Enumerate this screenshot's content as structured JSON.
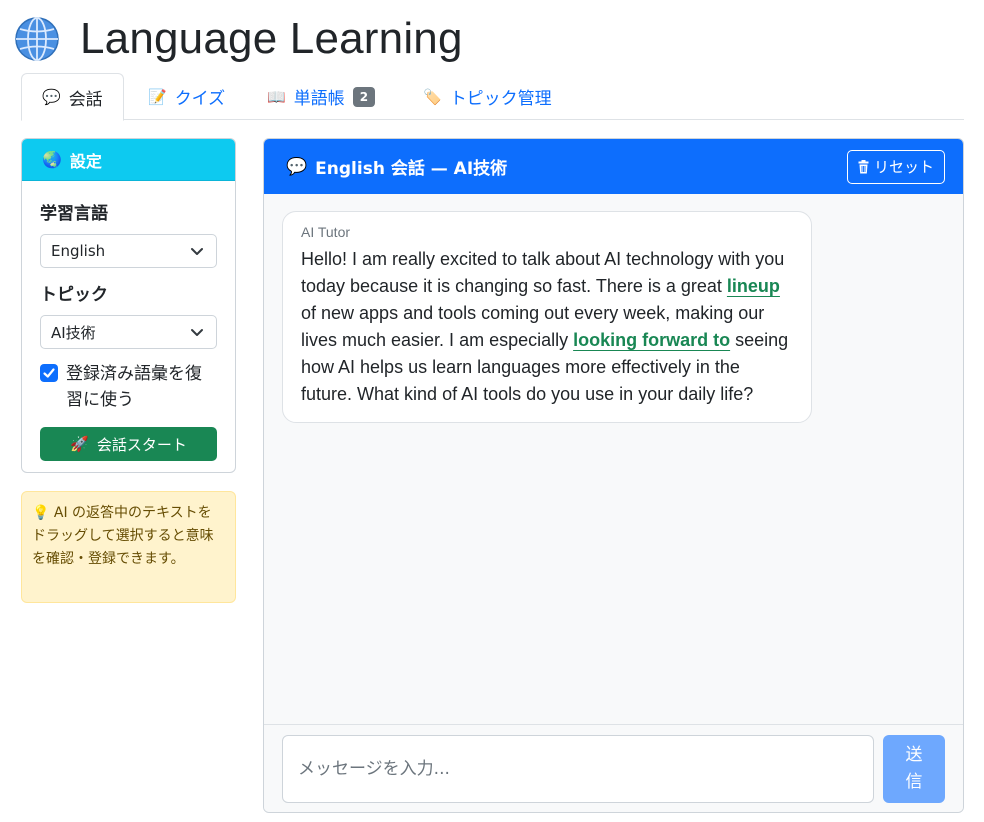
{
  "app": {
    "title": "Language Learning",
    "icon": "globe-icon"
  },
  "tabs": [
    {
      "label": "会話",
      "icon": "speech-bubble-icon",
      "active": true
    },
    {
      "label": "クイズ",
      "icon": "memo-icon",
      "active": false
    },
    {
      "label": "単語帳",
      "icon": "book-icon",
      "badge": "2",
      "active": false
    },
    {
      "label": "トピック管理",
      "icon": "tag-icon",
      "active": false
    }
  ],
  "settings": {
    "header": "設定",
    "language_label": "学習言語",
    "language_value": "English",
    "topic_label": "トピック",
    "topic_value": "AI技術",
    "use_vocab_label": "登録済み語彙を復習に使う",
    "use_vocab_checked": true,
    "start_button": "会話スタート"
  },
  "tip": {
    "text": "AI の返答中のテキストをドラッグして選択すると意味を確認・登録できます。"
  },
  "chat": {
    "title": "English 会話 — AI技術",
    "reset_button": "リセット",
    "messages": [
      {
        "sender": "AI Tutor",
        "segments": [
          "Hello! I am really excited to talk about AI technology with you today because it is changing so fast. There is a great ",
          "lineup",
          " of new apps and tools coming out every week, making our lives much easier. I am especially ",
          "looking forward to",
          " seeing how AI helps us learn languages more effectively in the future. What kind of AI tools do you use in your daily life?"
        ]
      }
    ],
    "input_placeholder": "メッセージを入力...",
    "send_button": "送信"
  },
  "colors": {
    "primary": "#0d6efd",
    "info": "#0dcaf0",
    "success": "#198754",
    "warning_bg": "#fff3cd",
    "send_disabled": "#6ea8fe"
  }
}
